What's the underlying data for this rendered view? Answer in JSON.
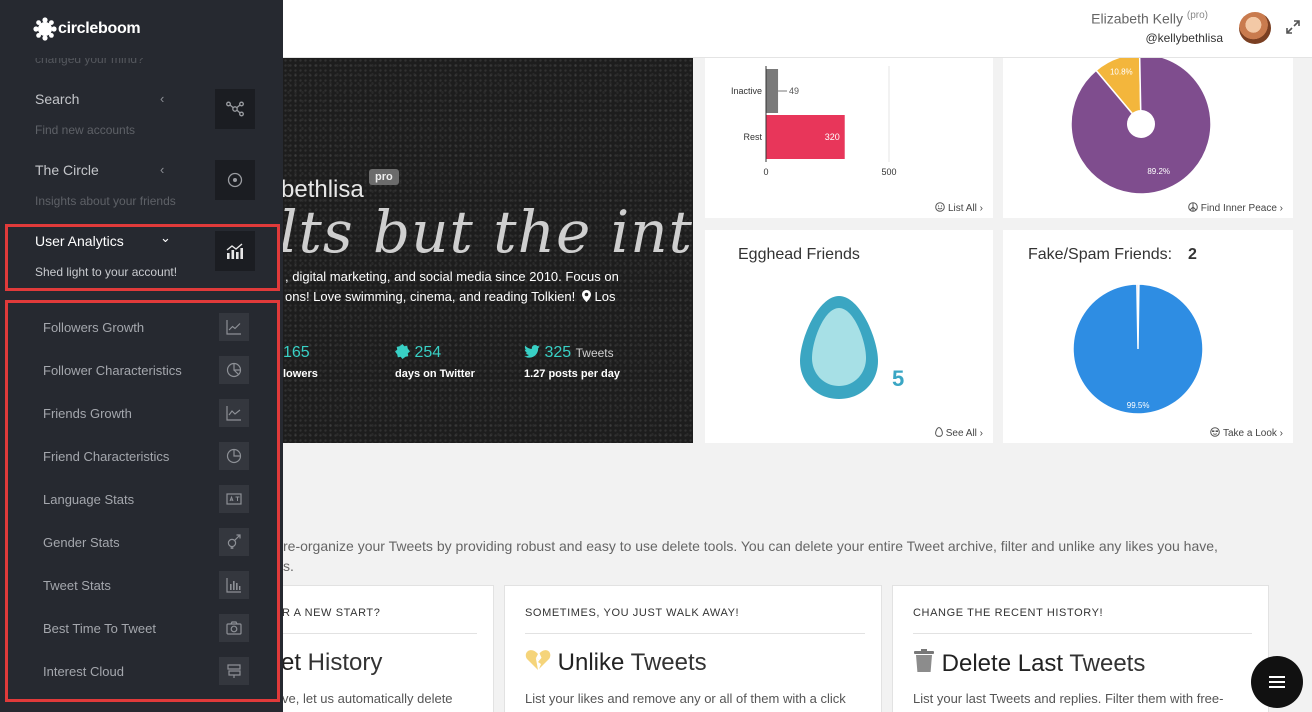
{
  "header": {
    "user_name": "Elizabeth Kelly",
    "user_tag": "(pro)",
    "handle": "@kellybethlisa"
  },
  "banner": {
    "username": "bethlisa",
    "badge": "pro",
    "quote": "lts but the inter",
    "bio_line1": ", digital marketing, and social media since 2010. Focus on",
    "bio_line2": "ons! Love swimming, cinema, and reading Tolkien!",
    "bio_location": "Los",
    "stats": [
      {
        "value": "165",
        "unit": "",
        "label": "lowers"
      },
      {
        "value": "254",
        "unit": "",
        "label": "days on Twitter"
      },
      {
        "value": "325",
        "unit": "Tweets",
        "label": "1.27 posts per day"
      }
    ]
  },
  "cards": {
    "inactive": {
      "link": "List All",
      "chart_data": {
        "type": "bar",
        "orientation": "horizontal",
        "categories": [
          "Inactive",
          "Rest"
        ],
        "values": [
          49,
          320
        ],
        "colors": [
          "#7a7a7a",
          "#e8365a"
        ],
        "xlim": [
          0,
          500
        ],
        "xticks": [
          "0",
          "500"
        ]
      }
    },
    "inner_peace": {
      "link": "Find Inner Peace",
      "chart_data": {
        "type": "pie",
        "labels": [
          "10.8%",
          "89.2%"
        ],
        "values": [
          10.8,
          89.2
        ],
        "colors": [
          "#f3b63c",
          "#7f4d8e"
        ]
      }
    },
    "egghead": {
      "title": "Egghead Friends",
      "count": "5",
      "link": "See All"
    },
    "fake_spam": {
      "title": "Fake/Spam Friends:",
      "count": "2",
      "link": "Take a Look",
      "chart_data": {
        "type": "pie",
        "labels": [
          "",
          "99.5%"
        ],
        "values": [
          0.5,
          99.5
        ],
        "colors": [
          "#e8b8b8",
          "#2e8de3"
        ]
      }
    }
  },
  "tools": {
    "description_line1": "re-organize your Tweets by providing robust and easy to use delete tools. You can delete your entire Tweet archive, filter and unlike any likes you have,",
    "description_line2": "s.",
    "items": [
      {
        "eyebrow": "R A NEW START?",
        "title_bold": "et",
        "title_rest": " History",
        "desc": "ve, let us automatically delete"
      },
      {
        "eyebrow": "SOMETIMES, YOU JUST WALK AWAY!",
        "title_bold": "Unlike",
        "title_rest": " Tweets",
        "desc": "List your likes and remove any or all of them with a click"
      },
      {
        "eyebrow": "CHANGE THE RECENT HISTORY!",
        "title_bold": "Delete Last",
        "title_rest": " Tweets",
        "desc": "List your last Tweets and replies. Filter them with free-"
      }
    ]
  },
  "sidebar": {
    "brand": "circleboom",
    "ghost_text": "changed your mind?",
    "menus": [
      {
        "title": "Search",
        "subtitle": "Find new accounts",
        "icon": "network-icon"
      },
      {
        "title": "The Circle",
        "subtitle": "Insights about your friends",
        "icon": "target-icon"
      },
      {
        "title": "User Analytics",
        "subtitle": "Shed light to your account!",
        "icon": "analytics-chart-icon"
      }
    ],
    "sub_items": [
      {
        "label": "Followers Growth",
        "icon": "line-chart-icon"
      },
      {
        "label": "Follower Characteristics",
        "icon": "pie-chart-icon"
      },
      {
        "label": "Friends Growth",
        "icon": "line-chart-icon"
      },
      {
        "label": "Friend Characteristics",
        "icon": "pie-chart-icon"
      },
      {
        "label": "Language Stats",
        "icon": "translate-icon"
      },
      {
        "label": "Gender Stats",
        "icon": "gender-icon"
      },
      {
        "label": "Tweet Stats",
        "icon": "bar-chart-icon"
      },
      {
        "label": "Best Time To Tweet",
        "icon": "camera-icon"
      },
      {
        "label": "Interest Cloud",
        "icon": "signpost-icon"
      }
    ]
  }
}
